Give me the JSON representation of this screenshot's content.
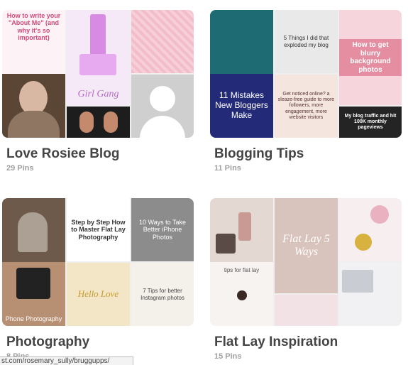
{
  "boards": [
    {
      "title": "Love Rosiee Blog",
      "pin_count": "29 Pins",
      "tiles": {
        "main": "",
        "t1": "How to write your \"About Me\" (and why it's so important)",
        "t2": "Girl Gang",
        "t3": "",
        "t4": "",
        "t5": "",
        "t6": ""
      }
    },
    {
      "title": "Blogging Tips",
      "pin_count": "11 Pins",
      "tiles": {
        "main": "11 Mistakes New Bloggers Make",
        "t1": "",
        "t2": "5 Things I did that exploded my blog",
        "t3": "How to get blurry background photos",
        "t4": "Get noticed online? a sleaze-free guide to more followers, more engagement, more website visitors",
        "t5": "My blog traffic and hit 100K monthly pageviews",
        "t6": ""
      }
    },
    {
      "title": "Photography",
      "pin_count": "8 Pins",
      "tiles": {
        "main": "Phone Photography",
        "t1": "Step by Step How to Master Flat Lay Photography",
        "t2": "10 Ways to Take Better iPhone Photos",
        "t3": "Hello Love",
        "t4": "",
        "t5": "7 Tips for better Instagram photos",
        "t6": ""
      }
    },
    {
      "title": "Flat Lay Inspiration",
      "pin_count": "15 Pins",
      "tiles": {
        "main": "tips for flat lay",
        "t1": "Flat Lay 5 Ways",
        "t2": "",
        "t3": "",
        "t4": "",
        "t5": "",
        "t6": ""
      }
    }
  ],
  "status_bar": {
    "url": "st.com/rosemary_sully/bruggupps/"
  }
}
